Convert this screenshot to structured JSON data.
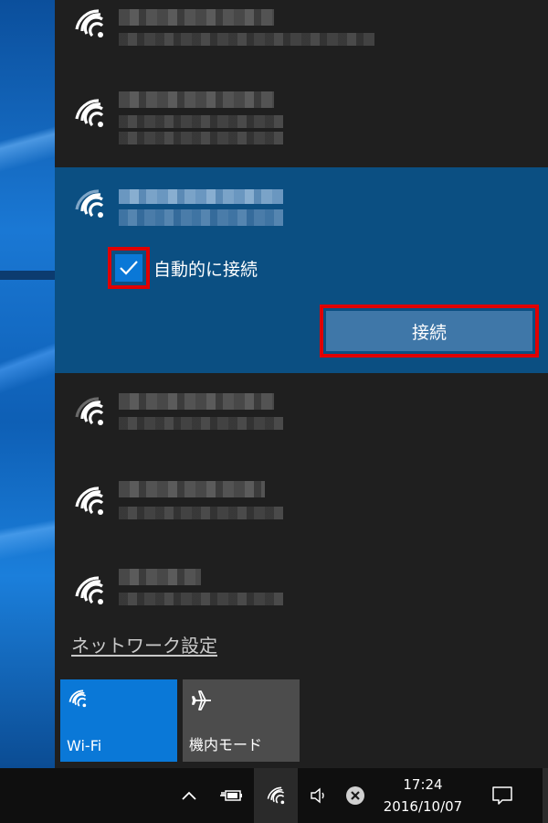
{
  "selected_network": {
    "auto_connect_label": "自動的に接続",
    "auto_connect_checked": true,
    "connect_button_label": "接続"
  },
  "network_settings_link": "ネットワーク設定",
  "quick_actions": [
    {
      "label": "Wi-Fi",
      "icon": "wifi-icon",
      "active": true
    },
    {
      "label": "機内モード",
      "icon": "airplane-icon",
      "active": false
    }
  ],
  "taskbar": {
    "time": "17:24",
    "date": "2016/10/07"
  },
  "colors": {
    "accent": "#0a78d7",
    "selected_bg": "#0b4f82",
    "highlight_border": "#e00000",
    "flyout_bg": "#1f1f1f"
  }
}
